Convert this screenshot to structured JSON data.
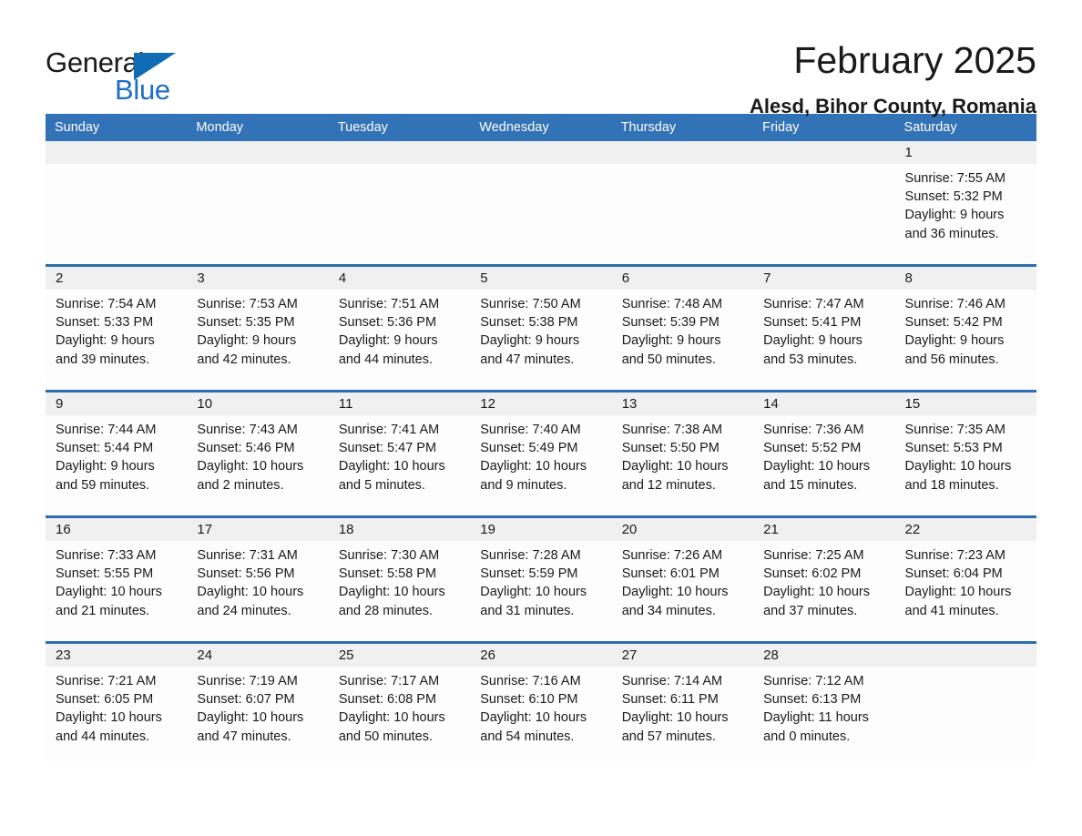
{
  "brand": {
    "name_part1": "General",
    "name_part2": "Blue",
    "triangle_icon": "triangle-logo-icon",
    "accent_color": "#0f6cb5"
  },
  "header": {
    "title": "February 2025",
    "subtitle": "Alesd, Bihor County, Romania"
  },
  "colors": {
    "header_bar": "#3272b6",
    "row_divider": "#2e6db0",
    "daynum_band": "#f0f0f0",
    "text": "#1a1a1a",
    "brand_blue": "#1f6fc4"
  },
  "weekdays": [
    "Sunday",
    "Monday",
    "Tuesday",
    "Wednesday",
    "Thursday",
    "Friday",
    "Saturday"
  ],
  "weeks": [
    {
      "days": [
        {
          "num": "",
          "sunrise": "",
          "sunset": "",
          "daylight_line1": "",
          "daylight_line2": "",
          "empty": true
        },
        {
          "num": "",
          "sunrise": "",
          "sunset": "",
          "daylight_line1": "",
          "daylight_line2": "",
          "empty": true
        },
        {
          "num": "",
          "sunrise": "",
          "sunset": "",
          "daylight_line1": "",
          "daylight_line2": "",
          "empty": true
        },
        {
          "num": "",
          "sunrise": "",
          "sunset": "",
          "daylight_line1": "",
          "daylight_line2": "",
          "empty": true
        },
        {
          "num": "",
          "sunrise": "",
          "sunset": "",
          "daylight_line1": "",
          "daylight_line2": "",
          "empty": true
        },
        {
          "num": "",
          "sunrise": "",
          "sunset": "",
          "daylight_line1": "",
          "daylight_line2": "",
          "empty": true
        },
        {
          "num": "1",
          "sunrise": "Sunrise: 7:55 AM",
          "sunset": "Sunset: 5:32 PM",
          "daylight_line1": "Daylight: 9 hours",
          "daylight_line2": "and 36 minutes.",
          "empty": false
        }
      ]
    },
    {
      "days": [
        {
          "num": "2",
          "sunrise": "Sunrise: 7:54 AM",
          "sunset": "Sunset: 5:33 PM",
          "daylight_line1": "Daylight: 9 hours",
          "daylight_line2": "and 39 minutes.",
          "empty": false
        },
        {
          "num": "3",
          "sunrise": "Sunrise: 7:53 AM",
          "sunset": "Sunset: 5:35 PM",
          "daylight_line1": "Daylight: 9 hours",
          "daylight_line2": "and 42 minutes.",
          "empty": false
        },
        {
          "num": "4",
          "sunrise": "Sunrise: 7:51 AM",
          "sunset": "Sunset: 5:36 PM",
          "daylight_line1": "Daylight: 9 hours",
          "daylight_line2": "and 44 minutes.",
          "empty": false
        },
        {
          "num": "5",
          "sunrise": "Sunrise: 7:50 AM",
          "sunset": "Sunset: 5:38 PM",
          "daylight_line1": "Daylight: 9 hours",
          "daylight_line2": "and 47 minutes.",
          "empty": false
        },
        {
          "num": "6",
          "sunrise": "Sunrise: 7:48 AM",
          "sunset": "Sunset: 5:39 PM",
          "daylight_line1": "Daylight: 9 hours",
          "daylight_line2": "and 50 minutes.",
          "empty": false
        },
        {
          "num": "7",
          "sunrise": "Sunrise: 7:47 AM",
          "sunset": "Sunset: 5:41 PM",
          "daylight_line1": "Daylight: 9 hours",
          "daylight_line2": "and 53 minutes.",
          "empty": false
        },
        {
          "num": "8",
          "sunrise": "Sunrise: 7:46 AM",
          "sunset": "Sunset: 5:42 PM",
          "daylight_line1": "Daylight: 9 hours",
          "daylight_line2": "and 56 minutes.",
          "empty": false
        }
      ]
    },
    {
      "days": [
        {
          "num": "9",
          "sunrise": "Sunrise: 7:44 AM",
          "sunset": "Sunset: 5:44 PM",
          "daylight_line1": "Daylight: 9 hours",
          "daylight_line2": "and 59 minutes.",
          "empty": false
        },
        {
          "num": "10",
          "sunrise": "Sunrise: 7:43 AM",
          "sunset": "Sunset: 5:46 PM",
          "daylight_line1": "Daylight: 10 hours",
          "daylight_line2": "and 2 minutes.",
          "empty": false
        },
        {
          "num": "11",
          "sunrise": "Sunrise: 7:41 AM",
          "sunset": "Sunset: 5:47 PM",
          "daylight_line1": "Daylight: 10 hours",
          "daylight_line2": "and 5 minutes.",
          "empty": false
        },
        {
          "num": "12",
          "sunrise": "Sunrise: 7:40 AM",
          "sunset": "Sunset: 5:49 PM",
          "daylight_line1": "Daylight: 10 hours",
          "daylight_line2": "and 9 minutes.",
          "empty": false
        },
        {
          "num": "13",
          "sunrise": "Sunrise: 7:38 AM",
          "sunset": "Sunset: 5:50 PM",
          "daylight_line1": "Daylight: 10 hours",
          "daylight_line2": "and 12 minutes.",
          "empty": false
        },
        {
          "num": "14",
          "sunrise": "Sunrise: 7:36 AM",
          "sunset": "Sunset: 5:52 PM",
          "daylight_line1": "Daylight: 10 hours",
          "daylight_line2": "and 15 minutes.",
          "empty": false
        },
        {
          "num": "15",
          "sunrise": "Sunrise: 7:35 AM",
          "sunset": "Sunset: 5:53 PM",
          "daylight_line1": "Daylight: 10 hours",
          "daylight_line2": "and 18 minutes.",
          "empty": false
        }
      ]
    },
    {
      "days": [
        {
          "num": "16",
          "sunrise": "Sunrise: 7:33 AM",
          "sunset": "Sunset: 5:55 PM",
          "daylight_line1": "Daylight: 10 hours",
          "daylight_line2": "and 21 minutes.",
          "empty": false
        },
        {
          "num": "17",
          "sunrise": "Sunrise: 7:31 AM",
          "sunset": "Sunset: 5:56 PM",
          "daylight_line1": "Daylight: 10 hours",
          "daylight_line2": "and 24 minutes.",
          "empty": false
        },
        {
          "num": "18",
          "sunrise": "Sunrise: 7:30 AM",
          "sunset": "Sunset: 5:58 PM",
          "daylight_line1": "Daylight: 10 hours",
          "daylight_line2": "and 28 minutes.",
          "empty": false
        },
        {
          "num": "19",
          "sunrise": "Sunrise: 7:28 AM",
          "sunset": "Sunset: 5:59 PM",
          "daylight_line1": "Daylight: 10 hours",
          "daylight_line2": "and 31 minutes.",
          "empty": false
        },
        {
          "num": "20",
          "sunrise": "Sunrise: 7:26 AM",
          "sunset": "Sunset: 6:01 PM",
          "daylight_line1": "Daylight: 10 hours",
          "daylight_line2": "and 34 minutes.",
          "empty": false
        },
        {
          "num": "21",
          "sunrise": "Sunrise: 7:25 AM",
          "sunset": "Sunset: 6:02 PM",
          "daylight_line1": "Daylight: 10 hours",
          "daylight_line2": "and 37 minutes.",
          "empty": false
        },
        {
          "num": "22",
          "sunrise": "Sunrise: 7:23 AM",
          "sunset": "Sunset: 6:04 PM",
          "daylight_line1": "Daylight: 10 hours",
          "daylight_line2": "and 41 minutes.",
          "empty": false
        }
      ]
    },
    {
      "days": [
        {
          "num": "23",
          "sunrise": "Sunrise: 7:21 AM",
          "sunset": "Sunset: 6:05 PM",
          "daylight_line1": "Daylight: 10 hours",
          "daylight_line2": "and 44 minutes.",
          "empty": false
        },
        {
          "num": "24",
          "sunrise": "Sunrise: 7:19 AM",
          "sunset": "Sunset: 6:07 PM",
          "daylight_line1": "Daylight: 10 hours",
          "daylight_line2": "and 47 minutes.",
          "empty": false
        },
        {
          "num": "25",
          "sunrise": "Sunrise: 7:17 AM",
          "sunset": "Sunset: 6:08 PM",
          "daylight_line1": "Daylight: 10 hours",
          "daylight_line2": "and 50 minutes.",
          "empty": false
        },
        {
          "num": "26",
          "sunrise": "Sunrise: 7:16 AM",
          "sunset": "Sunset: 6:10 PM",
          "daylight_line1": "Daylight: 10 hours",
          "daylight_line2": "and 54 minutes.",
          "empty": false
        },
        {
          "num": "27",
          "sunrise": "Sunrise: 7:14 AM",
          "sunset": "Sunset: 6:11 PM",
          "daylight_line1": "Daylight: 10 hours",
          "daylight_line2": "and 57 minutes.",
          "empty": false
        },
        {
          "num": "28",
          "sunrise": "Sunrise: 7:12 AM",
          "sunset": "Sunset: 6:13 PM",
          "daylight_line1": "Daylight: 11 hours",
          "daylight_line2": "and 0 minutes.",
          "empty": false
        },
        {
          "num": "",
          "sunrise": "",
          "sunset": "",
          "daylight_line1": "",
          "daylight_line2": "",
          "empty": true
        }
      ]
    }
  ]
}
